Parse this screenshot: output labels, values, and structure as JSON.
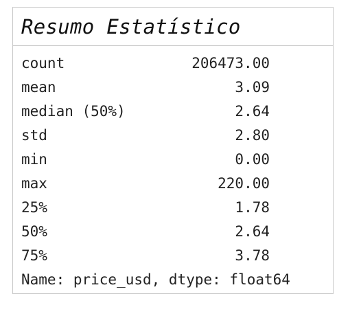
{
  "title": "Resumo Estatístico",
  "stats": [
    {
      "label": "count",
      "value": "206473.00"
    },
    {
      "label": "mean",
      "value": "3.09"
    },
    {
      "label": "median (50%)",
      "value": "2.64"
    },
    {
      "label": "std",
      "value": "2.80"
    },
    {
      "label": "min",
      "value": "0.00"
    },
    {
      "label": "max",
      "value": "220.00"
    },
    {
      "label": "25%",
      "value": "1.78"
    },
    {
      "label": "50%",
      "value": "2.64"
    },
    {
      "label": "75%",
      "value": "3.78"
    }
  ],
  "footer": "Name: price_usd, dtype: float64"
}
